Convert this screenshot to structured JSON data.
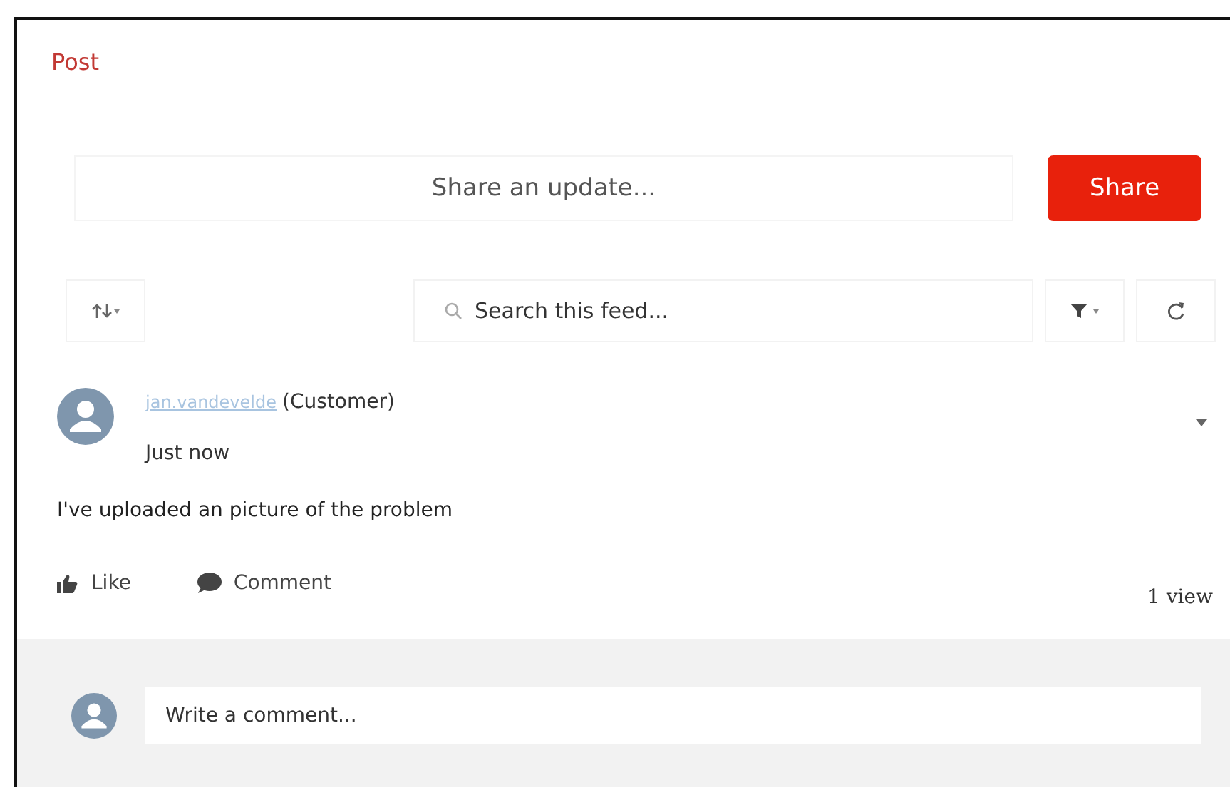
{
  "tabs": [
    {
      "label": "Post",
      "selected": true
    }
  ],
  "composer": {
    "placeholder": "Share an update...",
    "button": "Share"
  },
  "toolbar": {
    "search_placeholder": "Search this feed..."
  },
  "post": {
    "author": "jan.vandevelde",
    "role": "(Customer)",
    "time": "Just now",
    "body": "I've uploaded an picture of the problem",
    "actions": [
      "Like",
      "Comment"
    ],
    "views": "1 view"
  },
  "comment": {
    "placeholder": "Write a comment..."
  }
}
